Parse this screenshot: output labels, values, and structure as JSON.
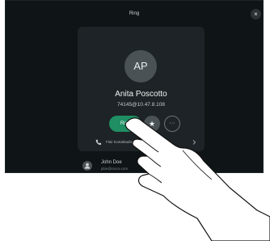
{
  "screen": {
    "title": "Ring",
    "close_icon": "×"
  },
  "contact": {
    "initials": "AP",
    "name": "Anita Poscotto",
    "address": "74145@10.47.8.108",
    "call_label": "Ring",
    "favorite_icon": "★",
    "more_icon": "···",
    "details_label": "Flair kontaktadresser"
  },
  "recent": {
    "name": "John Doe",
    "email": "jdoe@cisco.com"
  },
  "colors": {
    "background": "#0f1416",
    "card": "#1d2326",
    "call_button": "#1f8f63"
  }
}
